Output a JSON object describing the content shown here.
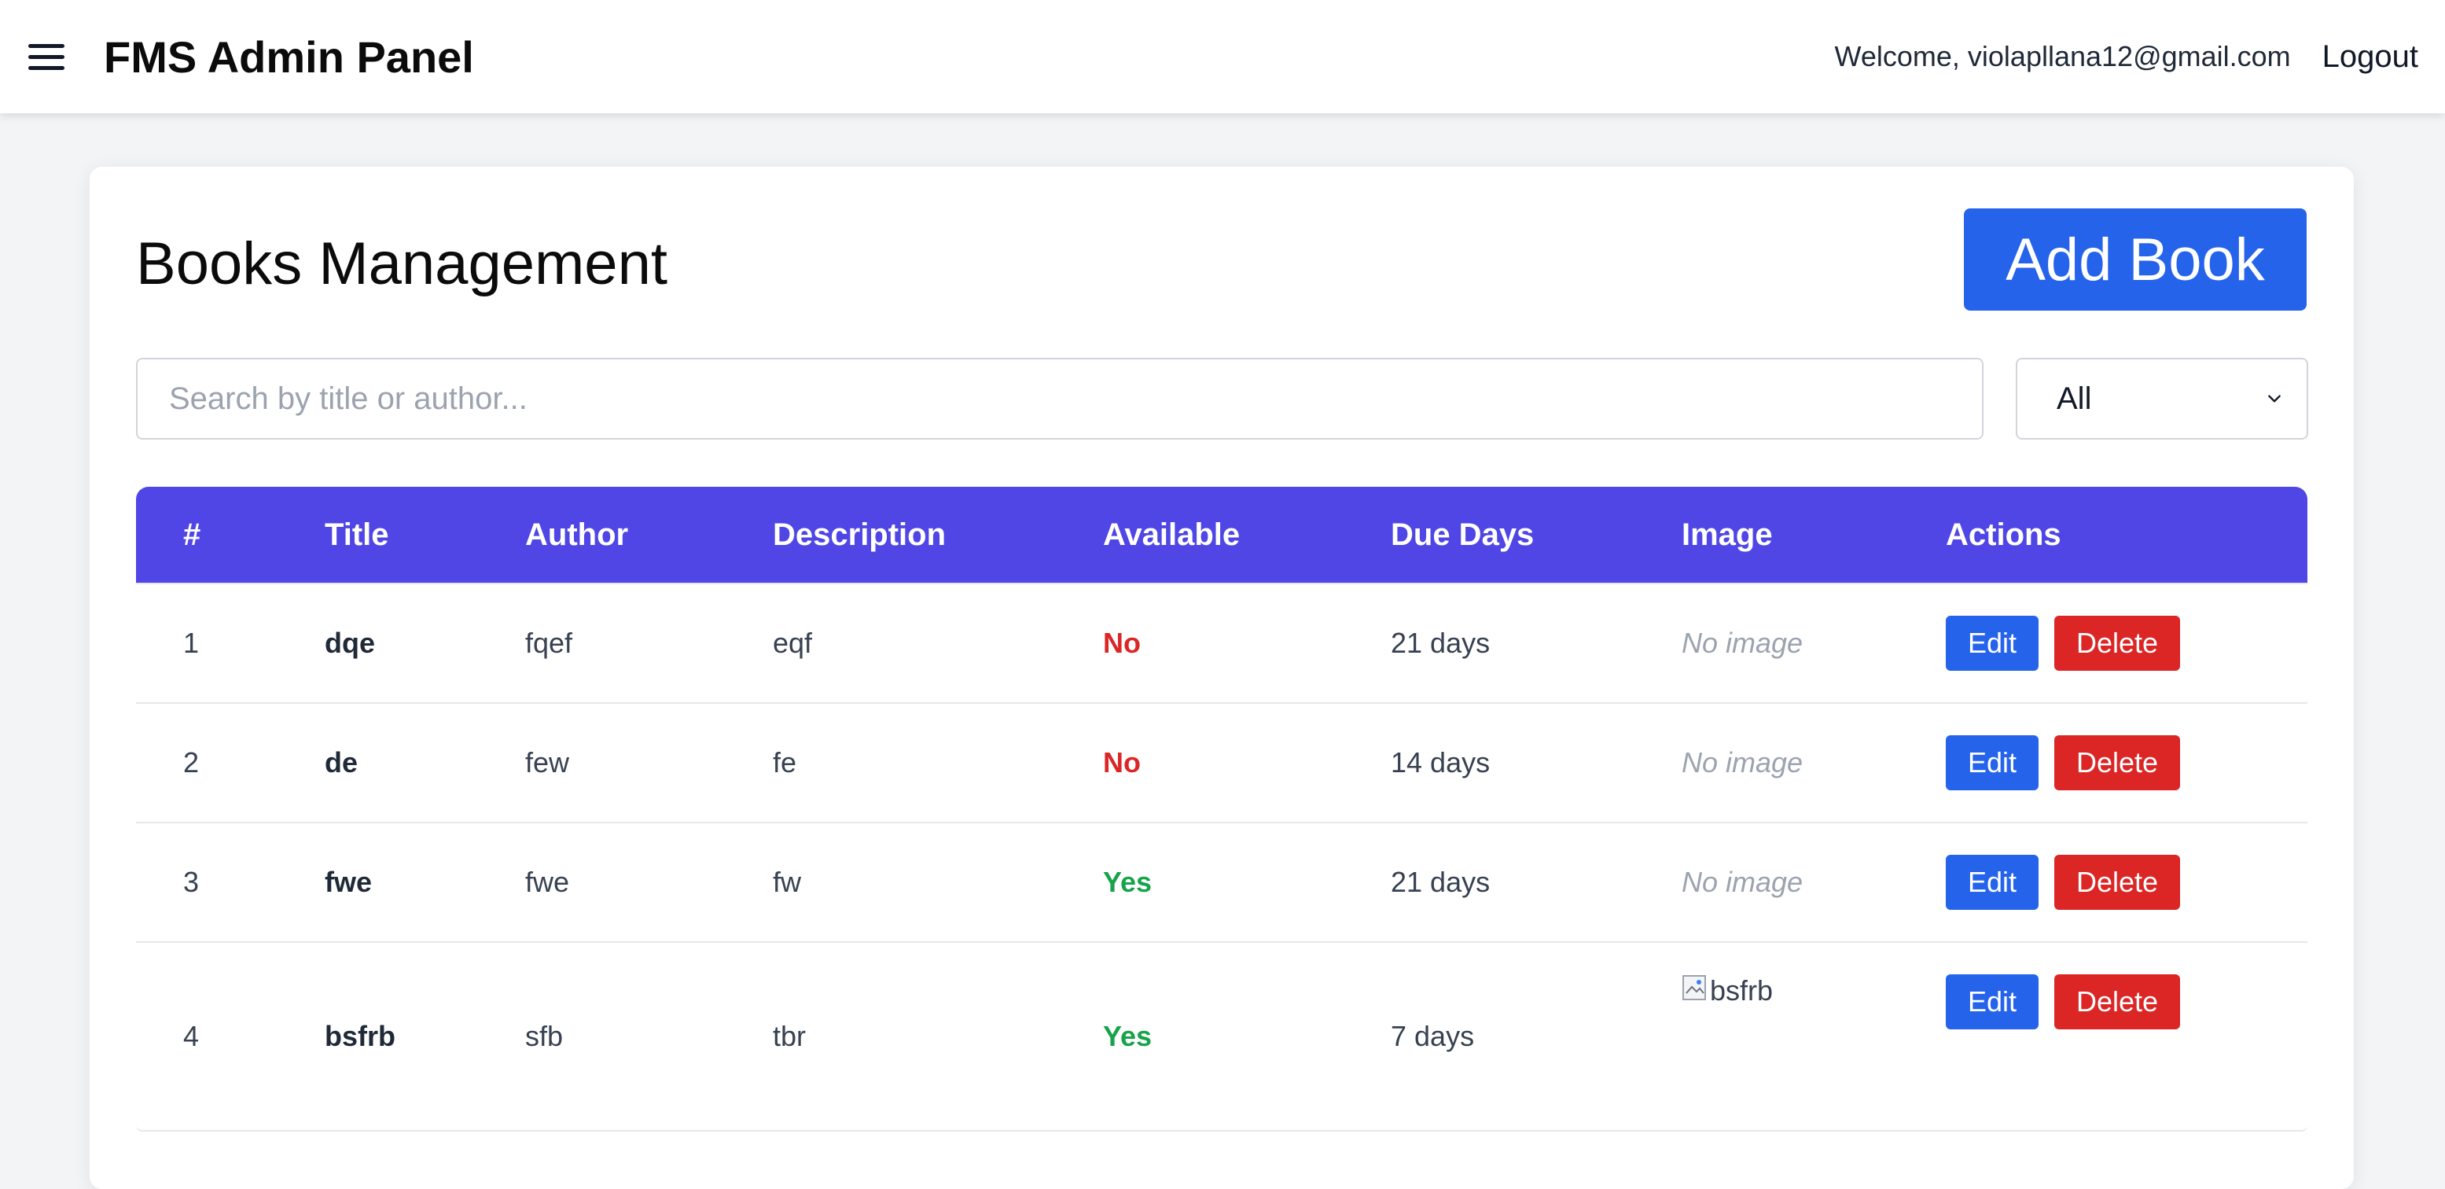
{
  "navbar": {
    "brand": "FMS Admin Panel",
    "welcome": "Welcome, violapllana12@gmail.com",
    "logout_label": "Logout"
  },
  "page": {
    "title": "Books Management",
    "add_button_label": "Add Book"
  },
  "search": {
    "placeholder": "Search by title or author...",
    "value": ""
  },
  "filter": {
    "selected": "All"
  },
  "table": {
    "headers": {
      "num": "#",
      "title": "Title",
      "author": "Author",
      "description": "Description",
      "available": "Available",
      "due_days": "Due Days",
      "image": "Image",
      "actions": "Actions"
    },
    "rows": [
      {
        "num": "1",
        "title": "dqe",
        "author": "fqef",
        "description": "eqf",
        "available": "No",
        "due_days": "21 days",
        "image": "No image",
        "edit": "Edit",
        "delete": "Delete"
      },
      {
        "num": "2",
        "title": "de",
        "author": "few",
        "description": "fe",
        "available": "No",
        "due_days": "14 days",
        "image": "No image",
        "edit": "Edit",
        "delete": "Delete"
      },
      {
        "num": "3",
        "title": "fwe",
        "author": "fwe",
        "description": "fw",
        "available": "Yes",
        "due_days": "21 days",
        "image": "No image",
        "edit": "Edit",
        "delete": "Delete"
      },
      {
        "num": "4",
        "title": "bsfrb",
        "author": "sfb",
        "description": "tbr",
        "available": "Yes",
        "due_days": "7 days",
        "image_alt": "bsfrb",
        "edit": "Edit",
        "delete": "Delete"
      }
    ]
  },
  "icons": {
    "menu": "hamburger-menu-icon",
    "chevron": "chevron-down-icon",
    "broken_image": "broken-image-icon"
  },
  "colors": {
    "primary": "#2563eb",
    "danger": "#dc2626",
    "success": "#16a34a",
    "table_header": "#4f46e5"
  }
}
